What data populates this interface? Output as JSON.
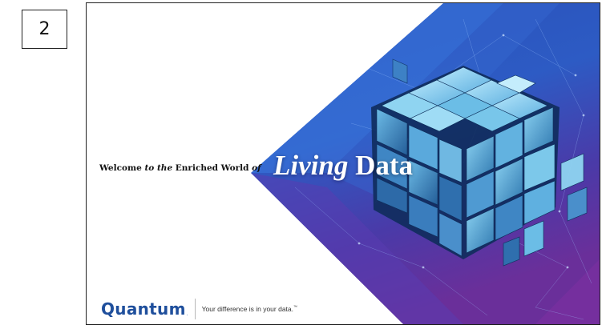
{
  "page_number": "2",
  "slide": {
    "welcome": {
      "part1": "Welcome ",
      "part2_italic": "to the",
      "part3": " Enriched World ",
      "part4_italic": "of"
    },
    "headline": {
      "living": "Living",
      "data": "Data"
    },
    "brand": {
      "logo": "Quantum",
      "logo_mark": ".",
      "tagline": "Your difference is in your data.",
      "tagline_tm": "™"
    },
    "colors": {
      "brand_blue": "#1f4f9c",
      "background_dark": "#1b2f86",
      "background_mid": "#2f63c8",
      "background_purple": "#6a2f9a",
      "cube_light": "#7cc8ea",
      "cube_dark": "#123a6a"
    }
  }
}
